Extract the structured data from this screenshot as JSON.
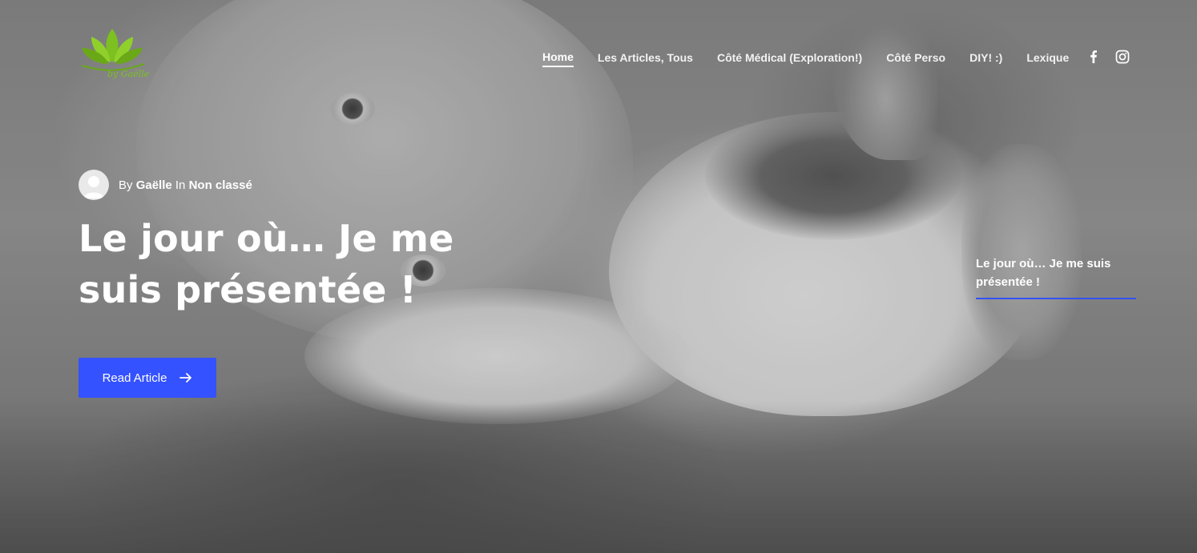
{
  "nav": {
    "items": [
      {
        "label": "Home",
        "active": true
      },
      {
        "label": "Les Articles, Tous",
        "active": false
      },
      {
        "label": "Côté Médical (Exploration!)",
        "active": false
      },
      {
        "label": "Côté Perso",
        "active": false
      },
      {
        "label": "DIY! :)",
        "active": false
      },
      {
        "label": "Lexique",
        "active": false
      }
    ]
  },
  "social": {
    "icons": [
      "facebook-icon",
      "instagram-icon"
    ]
  },
  "logo": {
    "script_text": "by Gaëlle",
    "leaf_color": "#7cc11f"
  },
  "post": {
    "by_label": "By",
    "author": "Gaëlle",
    "in_label": "In",
    "category": "Non classé",
    "title": "Le jour où… Je me suis présentée !",
    "button_label": "Read Article",
    "accent_color": "#3452ff"
  },
  "slider": {
    "current_title": "Le jour où… Je me suis présentée !"
  }
}
